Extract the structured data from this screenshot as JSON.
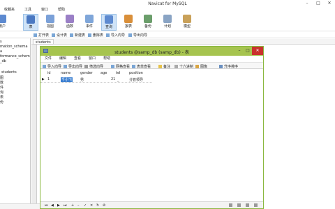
{
  "app": {
    "title": "Navicat for MySQL",
    "window_buttons": [
      "–",
      "□",
      "✕"
    ]
  },
  "menubar": {
    "items": [
      "收藏夹",
      "工具",
      "窗口",
      "帮助"
    ]
  },
  "ribbon": {
    "tools": [
      {
        "label": "用户",
        "color": "#5d8ad0"
      },
      {
        "label": "表",
        "color": "#4a78c2",
        "active": true
      },
      {
        "label": "视图",
        "color": "#7aa0d8"
      },
      {
        "label": "函数",
        "color": "#9a7fc6"
      },
      {
        "label": "事件",
        "color": "#7fa6d9"
      },
      {
        "label": "查询",
        "color": "#5d8ad0",
        "active": true
      },
      {
        "label": "报表",
        "color": "#d98f3a"
      },
      {
        "label": "备份",
        "color": "#6b9e6b"
      },
      {
        "label": "计划",
        "color": "#8aa4c4"
      },
      {
        "label": "模型",
        "color": "#c9a15a"
      }
    ]
  },
  "subtoolbar": {
    "buttons": [
      "打开表",
      "设计表",
      "新建表",
      "删除表",
      "导入向导",
      "导出向导"
    ]
  },
  "leftpane": {
    "items": [
      "s",
      "mation_schema",
      "a",
      "formance_schema",
      "_db",
      "students",
      "图",
      "数",
      "件",
      "询",
      "表",
      "份"
    ]
  },
  "object_tab": "students",
  "dialog": {
    "title": "students @samp_db (samp_db) - 表",
    "buttons": [
      "–",
      "□",
      "✕"
    ],
    "menu": [
      "文件",
      "编辑",
      "查看",
      "窗口",
      "帮助"
    ],
    "toolbar": [
      "导入向导",
      "导出向导",
      "筛选向导",
      "网格查看",
      "表单查看",
      "备注",
      "十六进制",
      "图像",
      "升序排序"
    ],
    "columns": [
      "id",
      "name",
      "gender",
      "age",
      "tel",
      "position"
    ],
    "row": {
      "marker": "▶",
      "id": "1",
      "name": "千小飞",
      "gender": "男",
      "age": "21",
      "tel": "_",
      "position": "分管领导"
    },
    "status_nav": [
      "⏮",
      "◀",
      "▶",
      "⏭",
      "+",
      "–",
      "✓",
      "✕",
      "↻",
      "⊘"
    ]
  }
}
